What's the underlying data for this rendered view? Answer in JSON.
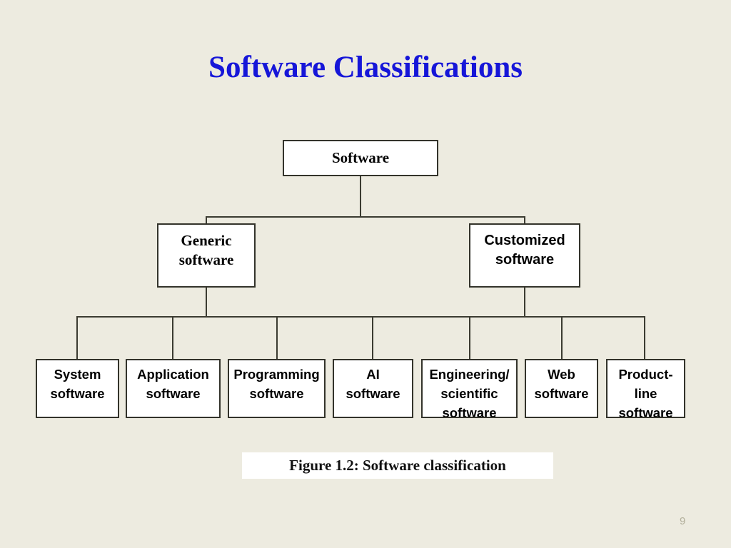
{
  "slide": {
    "title": "Software Classifications",
    "page_number": "9",
    "background_color": "#EDEBE0",
    "title_color": "#1616D8",
    "line_color": "#3B3B31",
    "box_border_color": "#33332B",
    "box_fill_color": "#FFFFFF"
  },
  "diagram": {
    "type": "tree",
    "root": {
      "label": "Software"
    },
    "level2": [
      {
        "label": "Generic\nsoftware"
      },
      {
        "label": "Customized\nsoftware"
      }
    ],
    "level3": [
      {
        "label": "System\nsoftware"
      },
      {
        "label": "Application\nsoftware"
      },
      {
        "label": "Programming\nsoftware"
      },
      {
        "label": "AI\nsoftware"
      },
      {
        "label": "Engineering/\nscientific\nsoftware"
      },
      {
        "label": "Web\nsoftware"
      },
      {
        "label": "Product-\nline\nsoftware"
      }
    ]
  },
  "caption": {
    "text": "Figure 1.2: Software classification"
  }
}
